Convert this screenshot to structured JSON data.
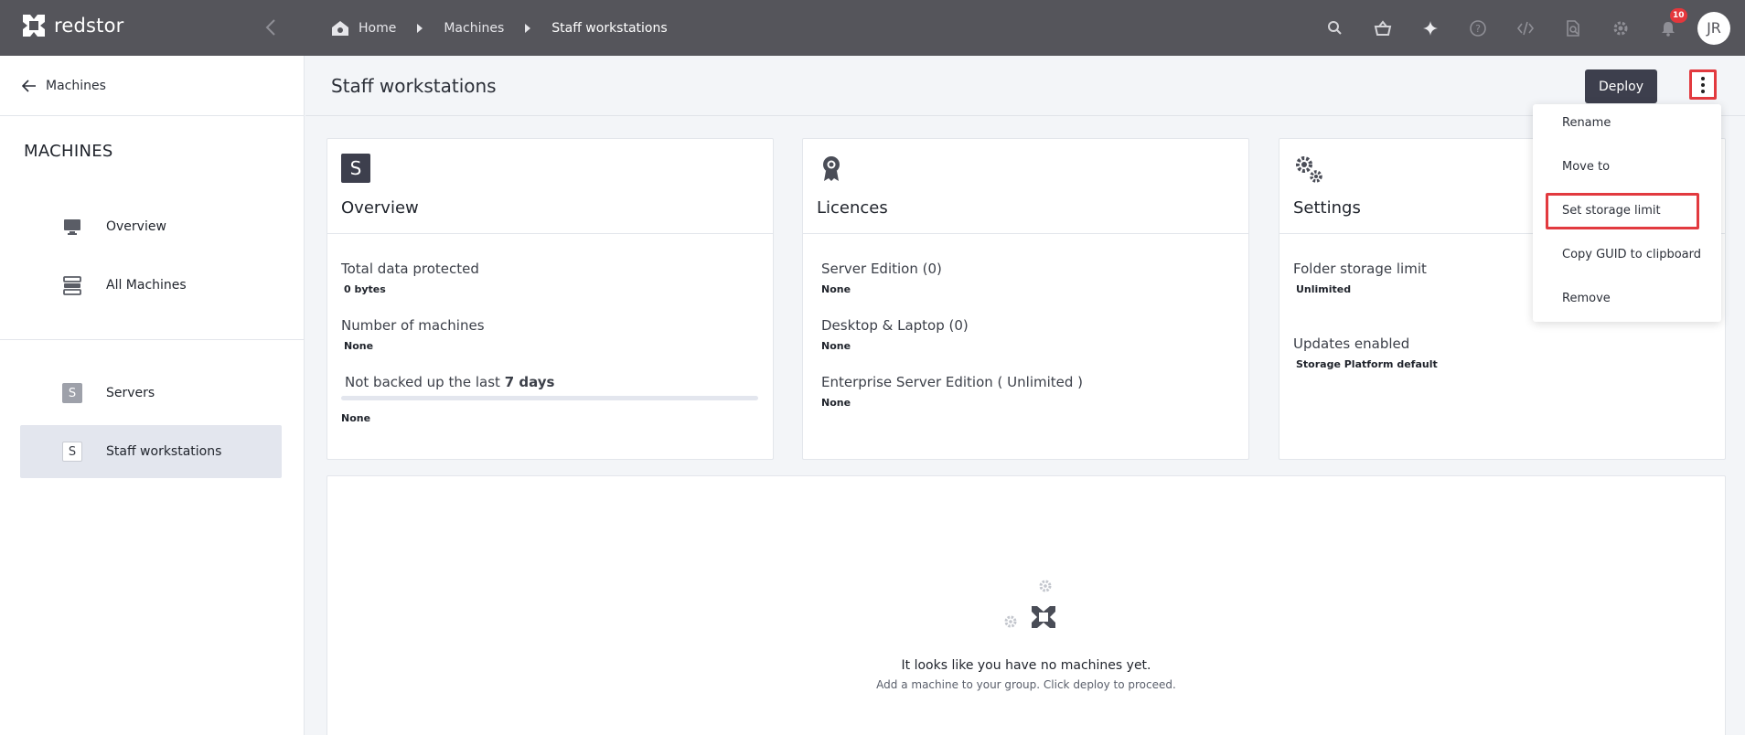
{
  "brand": {
    "name": "redstor"
  },
  "breadcrumb": {
    "home": "Home",
    "machines": "Machines",
    "current": "Staff workstations"
  },
  "topbar": {
    "notification_count": "10",
    "avatar_initials": "JR"
  },
  "sidebar": {
    "back_label": "Machines",
    "section_title": "MACHINES",
    "items": [
      {
        "label": "Overview"
      },
      {
        "label": "All Machines"
      }
    ],
    "groups": [
      {
        "tile": "S",
        "label": "Servers"
      },
      {
        "tile": "S",
        "label": "Staff workstations"
      }
    ]
  },
  "page": {
    "title": "Staff workstations",
    "deploy_label": "Deploy"
  },
  "cards": {
    "overview": {
      "tile": "S",
      "title": "Overview",
      "total_label": "Total data protected",
      "total_value": "0 bytes",
      "machines_label": "Number of machines",
      "machines_value": "None",
      "not_backed_prefix": "Not backed up the last",
      "not_backed_days": "7 days",
      "not_backed_value": "None"
    },
    "licences": {
      "title": "Licences",
      "server_label": "Server Edition (0)",
      "server_value": "None",
      "desktop_label": "Desktop & Laptop (0)",
      "desktop_value": "None",
      "enterprise_label": "Enterprise Server Edition ( Unlimited )",
      "enterprise_value": "None"
    },
    "settings": {
      "title": "Settings",
      "folder_label": "Folder storage limit",
      "folder_value": "Unlimited",
      "updates_label": "Updates enabled",
      "updates_value": "Storage Platform default"
    }
  },
  "empty_state": {
    "title": "It looks like you have no machines yet.",
    "subtitle": "Add a machine to your group. Click deploy to proceed."
  },
  "menu": {
    "rename": "Rename",
    "move_to": "Move to",
    "set_storage_limit": "Set storage limit",
    "copy_guid": "Copy GUID to clipboard",
    "remove": "Remove"
  },
  "colors": {
    "topbar": "#55555b",
    "highlight": "#e23a3f",
    "deploy": "#3d3f4d",
    "badge": "#e4373c"
  }
}
